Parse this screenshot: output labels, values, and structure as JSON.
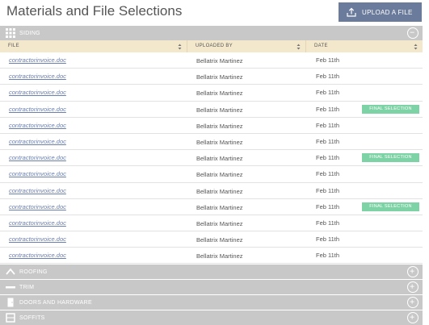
{
  "header": {
    "title": "Materials and File Selections",
    "upload_label": "UPLOAD A FILE"
  },
  "sections": [
    {
      "label": "SIDING",
      "icon": "grid-icon",
      "state": "expanded"
    },
    {
      "label": "ROOFING",
      "icon": "roof-icon",
      "state": "collapsed"
    },
    {
      "label": "TRIM",
      "icon": "trim-icon",
      "state": "collapsed"
    },
    {
      "label": "DOORS AND HARDWARE",
      "icon": "door-icon",
      "state": "collapsed"
    },
    {
      "label": "SOFFITS",
      "icon": "soffit-icon",
      "state": "collapsed"
    }
  ],
  "table": {
    "columns": [
      "FILE",
      "UPLOADED BY",
      "DATE"
    ],
    "rows": [
      {
        "file": "contractorinvoice.doc",
        "uploaded_by": "Bellatrix Martinez",
        "date": "Feb 11th",
        "badge": ""
      },
      {
        "file": "contractorinvoice.doc",
        "uploaded_by": "Bellatrix Martinez",
        "date": "Feb 11th",
        "badge": ""
      },
      {
        "file": "contractorinvoice.doc",
        "uploaded_by": "Bellatrix Martinez",
        "date": "Feb 11th",
        "badge": ""
      },
      {
        "file": "contractorinvoice.doc",
        "uploaded_by": "Bellatrix Martinez",
        "date": "Feb 11th",
        "badge": "FINAL SELECTION"
      },
      {
        "file": "contractorinvoice.doc",
        "uploaded_by": "Bellatrix Martinez",
        "date": "Feb 11th",
        "badge": ""
      },
      {
        "file": "contractorinvoice.doc",
        "uploaded_by": "Bellatrix Martinez",
        "date": "Feb 11th",
        "badge": ""
      },
      {
        "file": "contractorinvoice.doc",
        "uploaded_by": "Bellatrix Martinez",
        "date": "Feb 11th",
        "badge": "FINAL SELECTION"
      },
      {
        "file": "contractorinvoice.doc",
        "uploaded_by": "Bellatrix Martinez",
        "date": "Feb 11th",
        "badge": ""
      },
      {
        "file": "contractorinvoice.doc",
        "uploaded_by": "Bellatrix Martinez",
        "date": "Feb 11th",
        "badge": ""
      },
      {
        "file": "contractorinvoice.doc",
        "uploaded_by": "Bellatrix Martinez",
        "date": "Feb 11th",
        "badge": "FINAL SELECTION"
      },
      {
        "file": "contractorinvoice.doc",
        "uploaded_by": "Bellatrix Martinez",
        "date": "Feb 11th",
        "badge": ""
      },
      {
        "file": "contractorinvoice.doc",
        "uploaded_by": "Bellatrix Martinez",
        "date": "Feb 11th",
        "badge": ""
      },
      {
        "file": "contractorinvoice.doc",
        "uploaded_by": "Bellatrix Martinez",
        "date": "Feb 11th",
        "badge": ""
      }
    ]
  },
  "colors": {
    "upload_button": "#6b7b9c",
    "section_bar": "#c8c8c8",
    "column_header": "#f4e8cc",
    "badge": "#7ed3a6",
    "file_link": "#6a7fb0"
  }
}
